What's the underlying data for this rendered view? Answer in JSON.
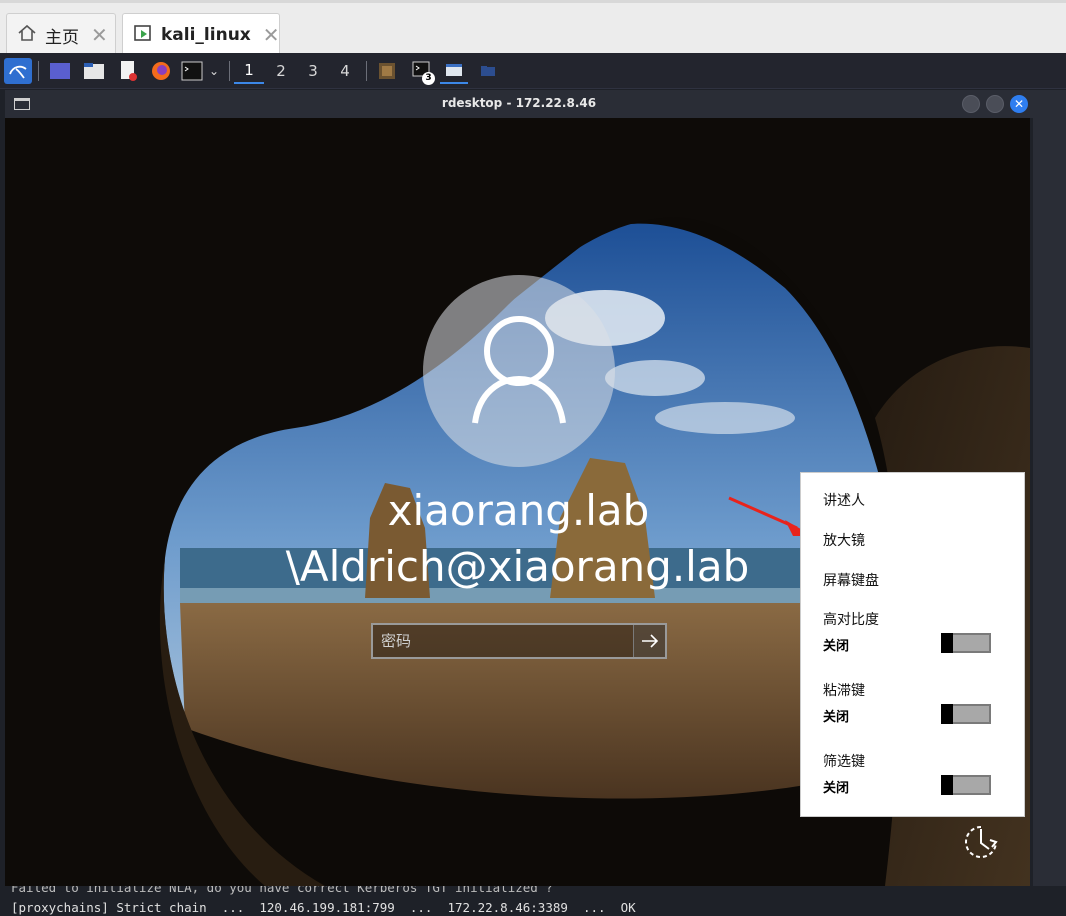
{
  "host_tabs": [
    {
      "label": "主页",
      "icon": "home-icon",
      "active": false
    },
    {
      "label": "kali_linux",
      "icon": "vm-play-icon",
      "active": true
    }
  ],
  "kali_panel": {
    "workspaces": [
      "1",
      "2",
      "3",
      "4"
    ],
    "active_workspace": "1",
    "badge": "3"
  },
  "window": {
    "title": "rdesktop - 172.22.8.46"
  },
  "login": {
    "user_line1": "xiaorang.lab",
    "user_line2": "\\Aldrich@xiaorang.lab",
    "password_placeholder": "密码"
  },
  "ease_menu": {
    "items": [
      "讲述人",
      "放大镜",
      "屏幕键盘"
    ],
    "toggles": [
      {
        "label": "高对比度",
        "state": "关闭"
      },
      {
        "label": "粘滞键",
        "state": "关闭"
      },
      {
        "label": "筛选键",
        "state": "关闭"
      }
    ]
  },
  "terminal": {
    "line1": "Failed to initialize NLA, do you have correct Kerberos TGT initialized ?",
    "line2": "[proxychains] Strict chain  ...  120.46.199.181:799  ...  172.22.8.46:3389  ...  OK"
  },
  "colors": {
    "accent": "#3c88e8",
    "panel_bg": "#23252e",
    "arrow_red": "#e8231c"
  }
}
